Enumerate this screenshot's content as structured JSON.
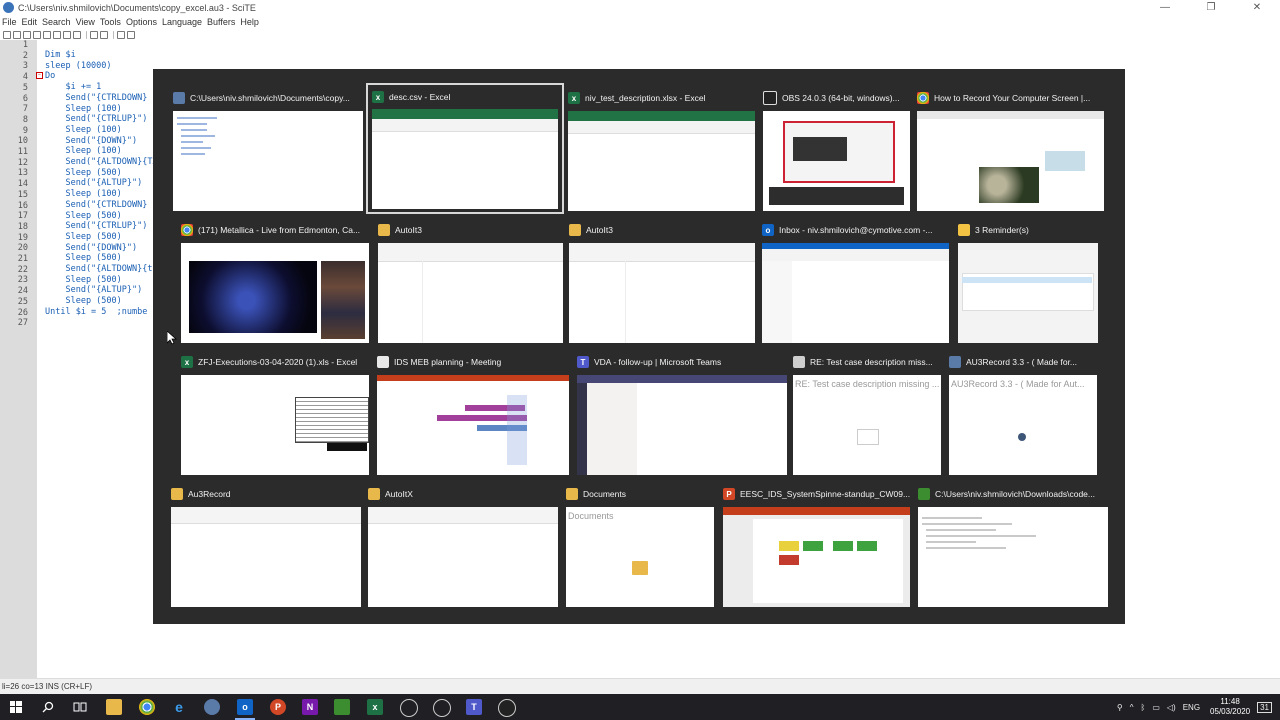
{
  "window": {
    "title": "C:\\Users\\niv.shmilovich\\Documents\\copy_excel.au3 - SciTE",
    "controls": [
      "—",
      "❐",
      "✕"
    ]
  },
  "menu": [
    "File",
    "Edit",
    "Search",
    "View",
    "Tools",
    "Options",
    "Language",
    "Buffers",
    "Help"
  ],
  "editor": {
    "line_numbers": [
      "1",
      "2",
      "3",
      "4",
      "5",
      "6",
      "7",
      "8",
      "9",
      "10",
      "11",
      "12",
      "13",
      "14",
      "15",
      "16",
      "17",
      "18",
      "19",
      "20",
      "21",
      "22",
      "23",
      "24",
      "25",
      "26",
      "27"
    ],
    "lines": [
      "Dim $i",
      "sleep (10000)",
      "Do",
      "    $i += 1",
      "    Send(\"{CTRLDOWN}",
      "    Sleep (100)",
      "    Send(\"{CTRLUP}\")",
      "    Sleep (100)",
      "    Send(\"{DOWN}\")",
      "    Sleep (100)",
      "    Send(\"{ALTDOWN}{TA",
      "    Sleep (500)",
      "    Send(\"{ALTUP}\")",
      "    Sleep (100)",
      "    Send(\"{CTRLDOWN}",
      "    Sleep (500)",
      "    Send(\"{CTRLUP}\")",
      "    Sleep (500)",
      "    Send(\"{DOWN}\")",
      "    Sleep (500)",
      "    Send(\"{ALTDOWN}{ta",
      "    Sleep (500)",
      "    Send(\"{ALTUP}\")",
      "    Sleep (500)",
      "Until $i = 5  ;numbe",
      ""
    ]
  },
  "status": "li=26 co=13 INS (CR+LF)",
  "switcher": {
    "tiles": [
      {
        "title": "C:\\Users\\niv.shmilovich\\Documents\\copy...",
        "icon": "autoit-icon"
      },
      {
        "title": "desc.csv - Excel",
        "icon": "excel-icon"
      },
      {
        "title": "niv_test_description.xlsx - Excel",
        "icon": "excel-icon"
      },
      {
        "title": "OBS 24.0.3 (64-bit, windows)...",
        "icon": "obs-icon"
      },
      {
        "title": "How to Record Your Computer Screen |...",
        "icon": "chrome-icon"
      },
      {
        "title": "(171) Metallica - Live from Edmonton, Ca...",
        "icon": "chrome-icon"
      },
      {
        "title": "AutoIt3",
        "icon": "folder-icon"
      },
      {
        "title": "AutoIt3",
        "icon": "folder-icon"
      },
      {
        "title": "Inbox - niv.shmilovich@cymotive.com -...",
        "icon": "outlook-icon"
      },
      {
        "title": "3 Reminder(s)",
        "icon": "bell-icon"
      },
      {
        "title": "ZFJ-Executions-03-04-2020 (1).xls - Excel",
        "icon": "excel-icon"
      },
      {
        "title": "IDS MEB planning - Meeting",
        "icon": "document-icon"
      },
      {
        "title": "VDA - follow-up | Microsoft Teams",
        "icon": "teams-icon"
      },
      {
        "title": "RE: Test case description miss...",
        "icon": "mail-icon"
      },
      {
        "title": "AU3Record 3.3 - ( Made for...",
        "icon": "autoit-icon"
      },
      {
        "title": "Au3Record",
        "icon": "folder-icon"
      },
      {
        "title": "AutoItX",
        "icon": "folder-icon"
      },
      {
        "title": "Documents",
        "icon": "folder-icon"
      },
      {
        "title": "EESC_IDS_SystemSpinne-standup_CW09...",
        "icon": "powerpoint-icon"
      },
      {
        "title": "C:\\Users\\niv.shmilovich\\Downloads\\code...",
        "icon": "notepad-icon"
      }
    ],
    "thumb_texts": {
      "mail": "RE: Test case description missing ...",
      "au3record": "AU3Record 3.3 - ( Made for Aut...",
      "documents": "Documents"
    }
  },
  "taskbar": {
    "language": "ENG",
    "time": "11:48",
    "date": "05/03/2020",
    "notifications": "31"
  }
}
